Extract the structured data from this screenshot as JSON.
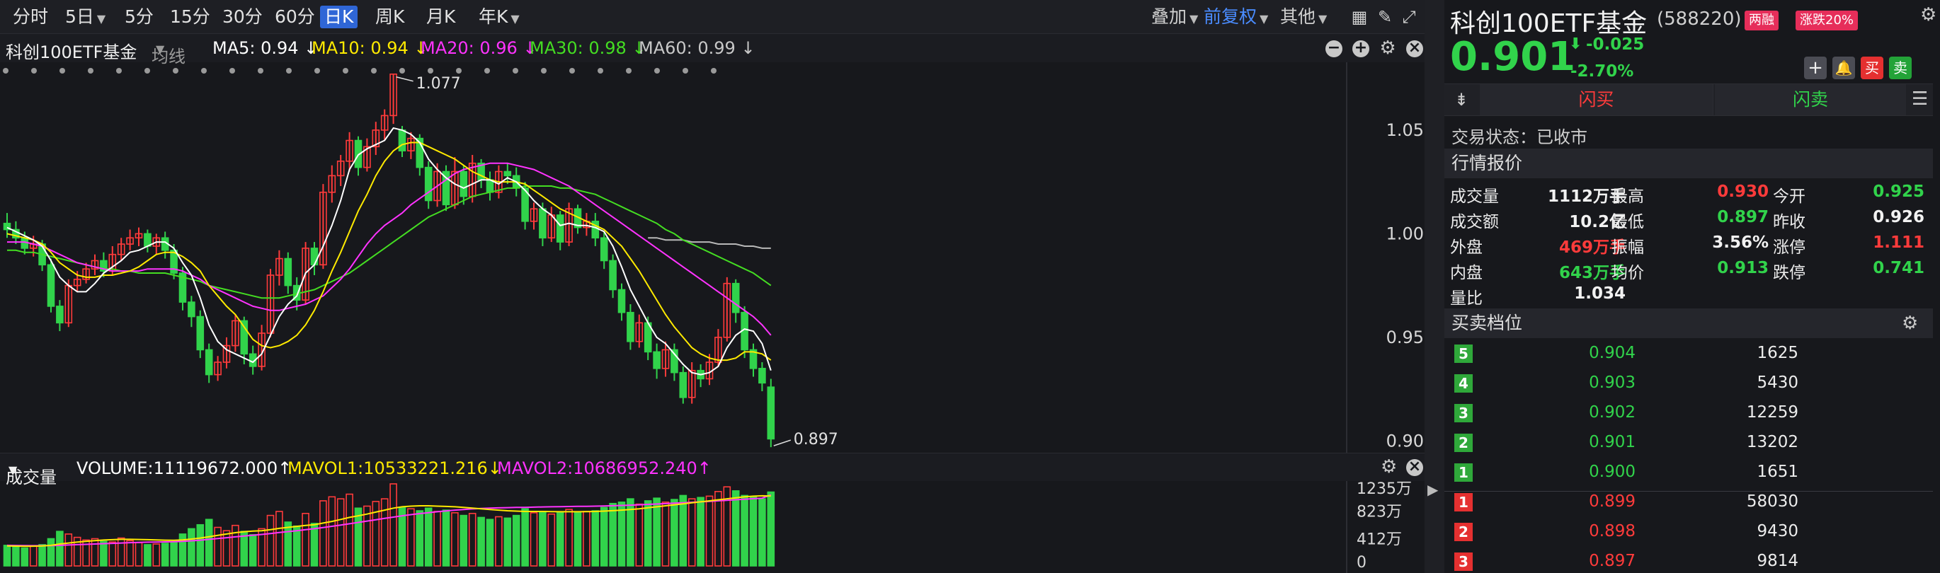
{
  "toolbar": {
    "periods": [
      "分时",
      "5日",
      "5分",
      "15分",
      "30分",
      "60分",
      "日K",
      "周K",
      "月K",
      "年K"
    ],
    "active_period": "日K",
    "overlay_label": "叠加",
    "adjust_label": "前复权",
    "other_label": "其他"
  },
  "infobar": {
    "name": "科创100ETF基金",
    "ma_type": "均线",
    "ma5": "MA5: 0.94 ↓",
    "ma10": "MA10: 0.94 ↓",
    "ma20": "MA20: 0.96 ↓",
    "ma30": "MA30: 0.98 ↓",
    "ma60": "MA60: 0.99 ↓"
  },
  "colors": {
    "up": "#ff3b3b",
    "down": "#31d34b",
    "ma5": "#ffffff",
    "ma10": "#ffea00",
    "ma20": "#ff33ff",
    "ma30": "#44dd22",
    "ma60": "#b8b8b8",
    "accent": "#2f66d6"
  },
  "chart_data": {
    "type": "candlestick",
    "y_ticks": [
      "1.050",
      "1.000",
      "0.950",
      "0.900"
    ],
    "ylim": [
      0.895,
      1.08
    ],
    "high_label": "1.077",
    "low_label": "0.897",
    "candles": [
      [
        1.005,
        1.002,
        1.01,
        0.998
      ],
      [
        1.002,
        0.998,
        1.006,
        0.995
      ],
      [
        0.998,
        0.993,
        1.001,
        0.99
      ],
      [
        0.993,
        0.995,
        0.999,
        0.989
      ],
      [
        0.995,
        0.985,
        0.997,
        0.982
      ],
      [
        0.985,
        0.965,
        0.988,
        0.962
      ],
      [
        0.965,
        0.957,
        0.968,
        0.953
      ],
      [
        0.957,
        0.975,
        0.978,
        0.955
      ],
      [
        0.975,
        0.978,
        0.982,
        0.972
      ],
      [
        0.978,
        0.983,
        0.986,
        0.976
      ],
      [
        0.983,
        0.987,
        0.99,
        0.98
      ],
      [
        0.987,
        0.982,
        0.991,
        0.979
      ],
      [
        0.982,
        0.99,
        0.994,
        0.98
      ],
      [
        0.99,
        0.995,
        0.998,
        0.987
      ],
      [
        0.995,
        0.998,
        1.002,
        0.992
      ],
      [
        0.998,
        1.0,
        1.003,
        0.994
      ],
      [
        1.0,
        0.994,
        1.002,
        0.991
      ],
      [
        0.994,
        0.998,
        1.0,
        0.99
      ],
      [
        0.998,
        0.992,
        1.001,
        0.988
      ],
      [
        0.992,
        0.981,
        0.995,
        0.978
      ],
      [
        0.981,
        0.967,
        0.984,
        0.963
      ],
      [
        0.967,
        0.96,
        0.97,
        0.955
      ],
      [
        0.96,
        0.944,
        0.963,
        0.94
      ],
      [
        0.944,
        0.932,
        0.947,
        0.928
      ],
      [
        0.932,
        0.938,
        0.941,
        0.929
      ],
      [
        0.938,
        0.946,
        0.95,
        0.935
      ],
      [
        0.946,
        0.958,
        0.961,
        0.943
      ],
      [
        0.958,
        0.942,
        0.96,
        0.937
      ],
      [
        0.942,
        0.936,
        0.946,
        0.932
      ],
      [
        0.936,
        0.952,
        0.956,
        0.934
      ],
      [
        0.952,
        0.98,
        0.983,
        0.95
      ],
      [
        0.98,
        0.988,
        0.992,
        0.975
      ],
      [
        0.988,
        0.975,
        0.991,
        0.971
      ],
      [
        0.975,
        0.968,
        0.979,
        0.963
      ],
      [
        0.968,
        0.993,
        0.996,
        0.966
      ],
      [
        0.993,
        0.985,
        0.996,
        0.98
      ],
      [
        0.985,
        1.02,
        1.024,
        0.983
      ],
      [
        1.02,
        1.028,
        1.033,
        1.015
      ],
      [
        1.028,
        1.035,
        1.038,
        1.023
      ],
      [
        1.035,
        1.045,
        1.049,
        1.03
      ],
      [
        1.045,
        1.032,
        1.047,
        1.028
      ],
      [
        1.032,
        1.042,
        1.046,
        1.03
      ],
      [
        1.042,
        1.05,
        1.054,
        1.038
      ],
      [
        1.05,
        1.057,
        1.06,
        1.045
      ],
      [
        1.057,
        1.077,
        1.077,
        1.053
      ],
      [
        1.05,
        1.04,
        1.052,
        1.037
      ],
      [
        1.04,
        1.046,
        1.049,
        1.036
      ],
      [
        1.046,
        1.032,
        1.048,
        1.028
      ],
      [
        1.032,
        1.016,
        1.035,
        1.012
      ],
      [
        1.016,
        1.03,
        1.034,
        1.013
      ],
      [
        1.03,
        1.014,
        1.033,
        1.011
      ],
      [
        1.014,
        1.03,
        1.037,
        1.012
      ],
      [
        1.03,
        1.018,
        1.033,
        1.014
      ],
      [
        1.018,
        1.034,
        1.038,
        1.015
      ],
      [
        1.034,
        1.026,
        1.036,
        1.022
      ],
      [
        1.026,
        1.02,
        1.03,
        1.016
      ],
      [
        1.02,
        1.03,
        1.033,
        1.017
      ],
      [
        1.03,
        1.028,
        1.034,
        1.024
      ],
      [
        1.028,
        1.022,
        1.032,
        1.018
      ],
      [
        1.022,
        1.006,
        1.025,
        1.002
      ],
      [
        1.006,
        1.012,
        1.015,
        1.002
      ],
      [
        1.012,
        0.998,
        1.015,
        0.994
      ],
      [
        0.998,
        1.009,
        1.013,
        0.996
      ],
      [
        1.009,
        0.996,
        1.011,
        0.992
      ],
      [
        0.996,
        1.012,
        1.015,
        0.994
      ],
      [
        1.012,
        1.003,
        1.014,
        1.0
      ],
      [
        1.003,
        1.006,
        1.01,
        0.999
      ],
      [
        1.006,
        0.998,
        1.01,
        0.994
      ],
      [
        0.998,
        0.987,
        1.001,
        0.983
      ],
      [
        0.987,
        0.973,
        0.99,
        0.969
      ],
      [
        0.973,
        0.962,
        0.976,
        0.958
      ],
      [
        0.962,
        0.948,
        0.966,
        0.944
      ],
      [
        0.948,
        0.957,
        0.961,
        0.945
      ],
      [
        0.957,
        0.943,
        0.96,
        0.939
      ],
      [
        0.943,
        0.935,
        0.947,
        0.93
      ],
      [
        0.935,
        0.944,
        0.948,
        0.931
      ],
      [
        0.944,
        0.933,
        0.947,
        0.929
      ],
      [
        0.933,
        0.921,
        0.936,
        0.918
      ],
      [
        0.921,
        0.934,
        0.938,
        0.918
      ],
      [
        0.934,
        0.93,
        0.937,
        0.926
      ],
      [
        0.93,
        0.938,
        0.942,
        0.927
      ],
      [
        0.938,
        0.95,
        0.954,
        0.936
      ],
      [
        0.95,
        0.976,
        0.979,
        0.948
      ],
      [
        0.976,
        0.962,
        0.978,
        0.957
      ],
      [
        0.962,
        0.944,
        0.965,
        0.94
      ],
      [
        0.944,
        0.935,
        0.947,
        0.931
      ],
      [
        0.935,
        0.928,
        0.938,
        0.924
      ],
      [
        0.926,
        0.901,
        0.93,
        0.897
      ]
    ],
    "ma5": [
      1.003,
      1.001,
      0.999,
      0.997,
      0.994,
      0.987,
      0.979,
      0.975,
      0.972,
      0.972,
      0.976,
      0.981,
      0.984,
      0.987,
      0.991,
      0.992,
      0.994,
      0.996,
      0.996,
      0.993,
      0.986,
      0.98,
      0.969,
      0.956,
      0.948,
      0.944,
      0.942,
      0.94,
      0.938,
      0.942,
      0.951,
      0.96,
      0.966,
      0.97,
      0.981,
      0.985,
      0.994,
      1.004,
      1.016,
      1.031,
      1.038,
      1.041,
      1.043,
      1.045,
      1.051,
      1.05,
      1.048,
      1.044,
      1.036,
      1.031,
      1.027,
      1.024,
      1.022,
      1.024,
      1.026,
      1.026,
      1.024,
      1.027,
      1.025,
      1.021,
      1.016,
      1.012,
      1.009,
      1.004,
      1.005,
      1.004,
      1.004,
      1.003,
      1.001,
      0.994,
      0.984,
      0.973,
      0.965,
      0.957,
      0.95,
      0.947,
      0.942,
      0.937,
      0.933,
      0.932,
      0.933,
      0.936,
      0.945,
      0.951,
      0.954,
      0.953,
      0.947,
      0.934
    ],
    "ma10": [
      1.0,
      0.999,
      0.998,
      0.997,
      0.995,
      0.991,
      0.986,
      0.983,
      0.98,
      0.979,
      0.979,
      0.98,
      0.98,
      0.981,
      0.982,
      0.984,
      0.987,
      0.99,
      0.991,
      0.991,
      0.989,
      0.986,
      0.982,
      0.975,
      0.97,
      0.965,
      0.961,
      0.955,
      0.949,
      0.946,
      0.945,
      0.946,
      0.948,
      0.951,
      0.956,
      0.963,
      0.972,
      0.982,
      0.991,
      1.001,
      1.011,
      1.019,
      1.028,
      1.035,
      1.04,
      1.043,
      1.044,
      1.044,
      1.042,
      1.04,
      1.038,
      1.036,
      1.033,
      1.03,
      1.028,
      1.026,
      1.025,
      1.025,
      1.025,
      1.024,
      1.021,
      1.018,
      1.015,
      1.012,
      1.01,
      1.008,
      1.006,
      1.004,
      1.002,
      0.998,
      0.994,
      0.988,
      0.982,
      0.975,
      0.968,
      0.961,
      0.955,
      0.95,
      0.945,
      0.942,
      0.94,
      0.939,
      0.939,
      0.94,
      0.943,
      0.943,
      0.942,
      0.939
    ],
    "ma20": [
      0.996,
      0.996,
      0.996,
      0.995,
      0.994,
      0.992,
      0.99,
      0.988,
      0.986,
      0.985,
      0.984,
      0.983,
      0.982,
      0.982,
      0.982,
      0.982,
      0.983,
      0.983,
      0.983,
      0.983,
      0.982,
      0.98,
      0.978,
      0.975,
      0.973,
      0.971,
      0.969,
      0.967,
      0.965,
      0.964,
      0.963,
      0.963,
      0.964,
      0.965,
      0.966,
      0.968,
      0.97,
      0.974,
      0.978,
      0.983,
      0.989,
      0.995,
      1.0,
      1.004,
      1.007,
      1.01,
      1.014,
      1.017,
      1.02,
      1.023,
      1.026,
      1.029,
      1.031,
      1.032,
      1.033,
      1.034,
      1.034,
      1.034,
      1.033,
      1.032,
      1.031,
      1.029,
      1.027,
      1.025,
      1.023,
      1.02,
      1.017,
      1.014,
      1.011,
      1.008,
      1.005,
      1.002,
      0.999,
      0.996,
      0.993,
      0.99,
      0.987,
      0.984,
      0.981,
      0.978,
      0.975,
      0.972,
      0.969,
      0.966,
      0.963,
      0.96,
      0.956,
      0.951
    ],
    "ma30": [
      0.992,
      0.992,
      0.991,
      0.991,
      0.99,
      0.989,
      0.988,
      0.987,
      0.986,
      0.985,
      0.984,
      0.983,
      0.983,
      0.982,
      0.982,
      0.981,
      0.981,
      0.981,
      0.981,
      0.98,
      0.979,
      0.978,
      0.977,
      0.975,
      0.974,
      0.973,
      0.972,
      0.971,
      0.97,
      0.969,
      0.969,
      0.969,
      0.97,
      0.971,
      0.972,
      0.973,
      0.975,
      0.977,
      0.979,
      0.981,
      0.984,
      0.987,
      0.99,
      0.993,
      0.996,
      0.999,
      1.002,
      1.005,
      1.008,
      1.01,
      1.012,
      1.014,
      1.016,
      1.018,
      1.019,
      1.02,
      1.021,
      1.022,
      1.022,
      1.023,
      1.023,
      1.023,
      1.023,
      1.022,
      1.022,
      1.021,
      1.02,
      1.019,
      1.017,
      1.015,
      1.013,
      1.011,
      1.009,
      1.007,
      1.005,
      1.002,
      1.0,
      0.997,
      0.995,
      0.993,
      0.991,
      0.989,
      0.987,
      0.985,
      0.983,
      0.981,
      0.978,
      0.975
    ],
    "ma60": [
      null,
      null,
      null,
      null,
      null,
      null,
      null,
      null,
      null,
      null,
      null,
      null,
      null,
      null,
      null,
      null,
      null,
      null,
      null,
      null,
      null,
      null,
      null,
      null,
      null,
      null,
      null,
      null,
      null,
      null,
      null,
      null,
      null,
      null,
      null,
      null,
      null,
      null,
      null,
      null,
      null,
      null,
      null,
      null,
      null,
      null,
      null,
      null,
      null,
      null,
      null,
      null,
      null,
      null,
      null,
      null,
      null,
      null,
      null,
      null,
      null,
      null,
      null,
      null,
      null,
      null,
      null,
      null,
      null,
      null,
      null,
      null,
      null,
      0.998,
      0.998,
      0.997,
      0.997,
      0.997,
      0.996,
      0.996,
      0.996,
      0.995,
      0.995,
      0.995,
      0.994,
      0.994,
      0.993,
      0.993
    ],
    "volume": [
      310,
      290,
      270,
      300,
      320,
      410,
      520,
      480,
      430,
      390,
      410,
      370,
      360,
      420,
      380,
      350,
      320,
      330,
      340,
      360,
      480,
      560,
      620,
      700,
      580,
      530,
      610,
      520,
      470,
      560,
      760,
      820,
      660,
      600,
      790,
      640,
      980,
      1040,
      1010,
      1080,
      870,
      900,
      970,
      1010,
      1235,
      880,
      860,
      830,
      870,
      820,
      840,
      800,
      760,
      790,
      730,
      700,
      740,
      720,
      760,
      860,
      800,
      820,
      780,
      800,
      850,
      810,
      820,
      830,
      880,
      940,
      960,
      1010,
      930,
      980,
      1020,
      960,
      1000,
      1060,
      1010,
      1030,
      1050,
      1120,
      1190,
      1130,
      1060,
      1040,
      1010,
      1112
    ],
    "mavol1": [
      300,
      298,
      296,
      297,
      300,
      310,
      330,
      345,
      360,
      370,
      380,
      390,
      395,
      400,
      400,
      398,
      395,
      392,
      388,
      385,
      392,
      405,
      420,
      440,
      460,
      480,
      500,
      515,
      525,
      530,
      545,
      565,
      580,
      595,
      610,
      620,
      645,
      670,
      700,
      730,
      755,
      780,
      810,
      840,
      870,
      890,
      900,
      905,
      905,
      900,
      895,
      890,
      880,
      870,
      860,
      850,
      840,
      830,
      825,
      820,
      820,
      820,
      818,
      815,
      815,
      816,
      818,
      820,
      825,
      832,
      840,
      850,
      860,
      875,
      890,
      905,
      920,
      935,
      950,
      965,
      980,
      995,
      1010,
      1025,
      1040,
      1050,
      1055,
      1053
    ],
    "mavol2": [
      310,
      308,
      306,
      305,
      304,
      305,
      310,
      315,
      320,
      325,
      330,
      335,
      340,
      345,
      350,
      355,
      358,
      360,
      362,
      365,
      370,
      378,
      388,
      400,
      412,
      425,
      438,
      450,
      462,
      474,
      488,
      502,
      516,
      530,
      545,
      560,
      578,
      596,
      615,
      635,
      655,
      675,
      695,
      715,
      735,
      755,
      772,
      788,
      802,
      815,
      828,
      840,
      850,
      858,
      865,
      870,
      874,
      877,
      880,
      882,
      885,
      888,
      890,
      892,
      894,
      896,
      898,
      900,
      903,
      906,
      910,
      915,
      920,
      926,
      932,
      938,
      944,
      951,
      958,
      965,
      972,
      980,
      988,
      996,
      1004,
      1012,
      1020,
      1069
    ],
    "vol_ticks": [
      "1235万",
      "823万",
      "412万",
      "0"
    ]
  },
  "volbar": {
    "title": "成交量",
    "volume": "VOLUME:11119672.000↑",
    "mavol1": "MAVOL1:10533221.216↓",
    "mavol2": "MAVOL2:10686952.240↑"
  },
  "quote": {
    "name": "科创100ETF基金",
    "code": "(588220)",
    "badge1": "两融",
    "badge2": "涨跌20%",
    "price": "0.901",
    "change": "-0.025",
    "change_pct": "-2.70%",
    "action_buy": "买",
    "action_sell": "卖",
    "flash_buy": "闪买",
    "flash_sell": "闪卖",
    "status": "交易状态：已收市",
    "market_title": "行情报价",
    "rows": [
      [
        "成交量",
        "1112万手",
        "最高",
        "0.930",
        "今开",
        "0.925"
      ],
      [
        "成交额",
        "10.2亿",
        "最低",
        "0.897",
        "昨收",
        "0.926"
      ],
      [
        "外盘",
        "469万手",
        "振幅",
        "3.56%",
        "涨停",
        "1.111"
      ],
      [
        "内盘",
        "643万手",
        "均价",
        "0.913",
        "跌停",
        "0.741"
      ]
    ],
    "ratio_label": "量比",
    "ratio_value": "1.034",
    "book_title": "买卖档位",
    "asks": [
      [
        "5",
        "0.904",
        "1625"
      ],
      [
        "4",
        "0.903",
        "5430"
      ],
      [
        "3",
        "0.902",
        "12259"
      ],
      [
        "2",
        "0.901",
        "13202"
      ],
      [
        "1",
        "0.900",
        "1651"
      ]
    ],
    "bids": [
      [
        "1",
        "0.899",
        "58030"
      ],
      [
        "2",
        "0.898",
        "9430"
      ],
      [
        "3",
        "0.897",
        "9814"
      ]
    ]
  }
}
